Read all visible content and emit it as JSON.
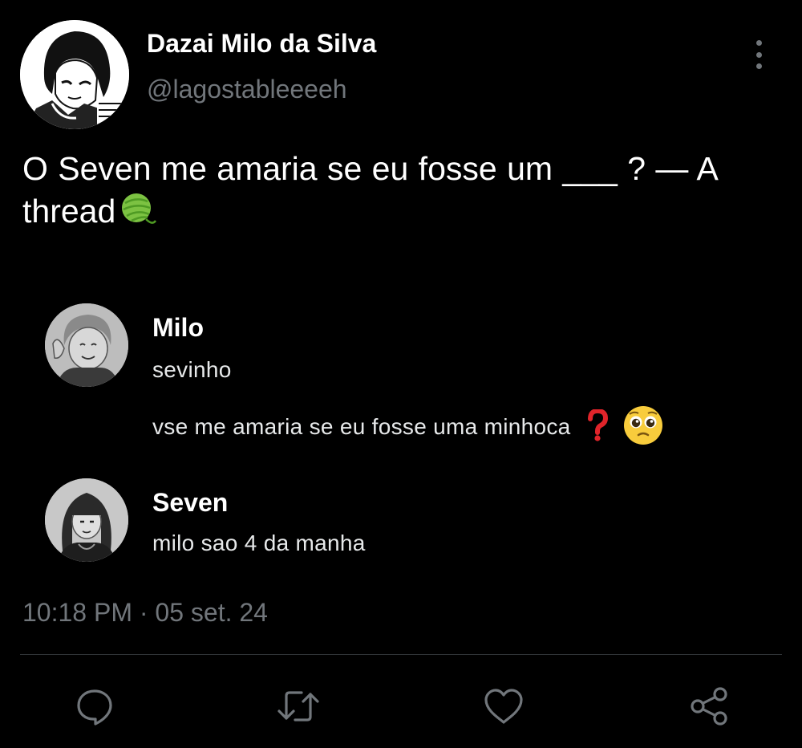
{
  "author": {
    "display_name": "Dazai Milo da Silva",
    "handle": "@lagostableeeeh",
    "avatar_icon": "anime-character-avatar"
  },
  "tweet": {
    "text": "O Seven me amaria se eu fosse um ___ ? — A thread",
    "emoji_icon": "yarn-ball-emoji"
  },
  "chat": [
    {
      "name": "Milo",
      "lines": [
        "sevinho",
        "vse me amaria se eu fosse uma minhoca"
      ],
      "emojis": [
        "red-question-mark-emoji",
        "pleading-face-emoji"
      ]
    },
    {
      "name": "Seven",
      "lines": [
        "milo sao 4 da manha"
      ]
    }
  ],
  "meta": {
    "timestamp": "10:18 PM · 05 set. 24"
  },
  "actions": [
    {
      "icon": "reply-icon"
    },
    {
      "icon": "retweet-icon"
    },
    {
      "icon": "like-icon"
    },
    {
      "icon": "share-icon"
    }
  ],
  "colors": {
    "background": "#000000",
    "text_primary": "#ffffff",
    "text_secondary": "#71767b",
    "divider": "#2f3336"
  }
}
